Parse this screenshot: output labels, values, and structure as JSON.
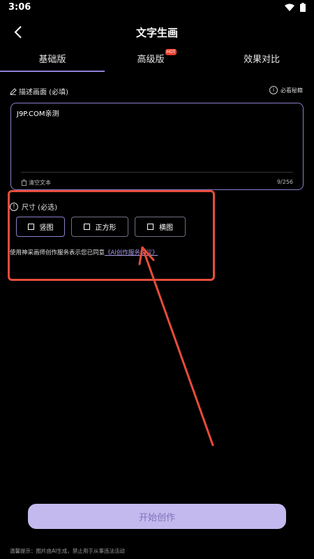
{
  "status_bar": {
    "time": "3:06"
  },
  "nav": {
    "title": "文字生画"
  },
  "tabs": [
    {
      "label": "基础版"
    },
    {
      "label": "高级版",
      "badge": "HOT"
    },
    {
      "label": "效果对比"
    }
  ],
  "description": {
    "label": "描述画面 (必填)",
    "tips_label": "必看秘籍",
    "value": "J9P.COM亲测",
    "clear_label": "清空文本",
    "char_count": "9/256"
  },
  "size": {
    "label": "尺寸 (必选)",
    "options": [
      {
        "label": "竖图"
      },
      {
        "label": "正方形"
      },
      {
        "label": "横图"
      }
    ]
  },
  "agreement": {
    "text": "使用神采画师创作服务表示您已同意",
    "link": "《AI创作服务协议》"
  },
  "start_button": {
    "label": "开始创作"
  },
  "footer": {
    "tip": "温馨提示：图片由AI生成，禁止用于从事违法活动"
  },
  "colors": {
    "accent": "#8a80c8",
    "button_bg": "#c3b9ee",
    "annotation": "#e74c3c",
    "hot_badge": "#e9412f"
  }
}
